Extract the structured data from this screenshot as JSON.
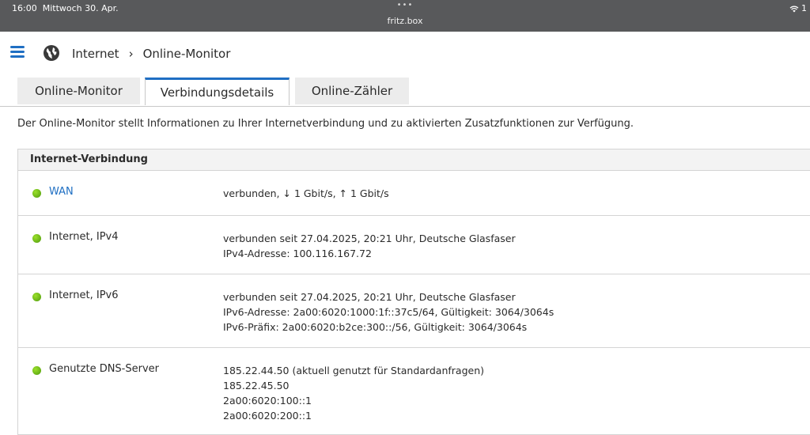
{
  "statusbar": {
    "time": "16:00",
    "date": "Mittwoch 30. Apr.",
    "dots": "•••",
    "url": "fritz.box",
    "battery_partial": "1"
  },
  "header": {
    "breadcrumb": [
      "Internet",
      "Online-Monitor"
    ],
    "separator": "›"
  },
  "tabs": [
    {
      "label": "Online-Monitor",
      "active": false
    },
    {
      "label": "Verbindungsdetails",
      "active": true
    },
    {
      "label": "Online-Zähler",
      "active": false
    }
  ],
  "intro": "Der Online-Monitor stellt Informationen zu Ihrer Internetverbindung und zu aktivierten Zusatzfunktionen zur Verfügung.",
  "panel": {
    "title": "Internet-Verbindung",
    "rows": [
      {
        "label": "WAN",
        "lines": [
          "verbunden, ↓ 1 Gbit/s, ↑ 1 Gbit/s"
        ]
      },
      {
        "label": "Internet, IPv4",
        "lines": [
          "verbunden seit 27.04.2025, 20:21 Uhr, Deutsche Glasfaser",
          "IPv4-Adresse: 100.116.167.72"
        ]
      },
      {
        "label": "Internet, IPv6",
        "lines": [
          "verbunden seit 27.04.2025, 20:21 Uhr, Deutsche Glasfaser",
          "IPv6-Adresse: 2a00:6020:1000:1f::37c5/64, Gültigkeit: 3064/3064s",
          "IPv6-Präfix: 2a00:6020:b2ce:300::/56, Gültigkeit: 3064/3064s"
        ]
      },
      {
        "label": "Genutzte DNS-Server",
        "lines": [
          "185.22.44.50 (aktuell genutzt für Standardanfragen)",
          "185.22.45.50",
          "2a00:6020:100::1",
          "2a00:6020:200::1"
        ]
      }
    ]
  },
  "colors": {
    "accent": "#1f6fc3",
    "status_ok": "#6cc218",
    "statusbar_bg": "#58595b"
  }
}
